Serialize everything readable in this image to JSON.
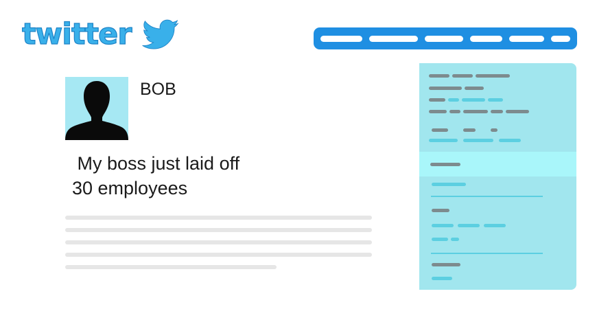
{
  "logo": {
    "text": "twitter",
    "brand_color": "#39b0ea",
    "icon": "bird-icon"
  },
  "navbar": {
    "color": "#1f8fe2",
    "item_count": 6
  },
  "tweet": {
    "author": "BOB",
    "text": " My boss just laid off\n30 employees",
    "avatar_icon": "user-silhouette-icon",
    "avatar_bg": "#a6e8f3"
  },
  "sidebar": {
    "bg": "#a1e6ee",
    "highlight_bg": "#a9f6fa"
  }
}
